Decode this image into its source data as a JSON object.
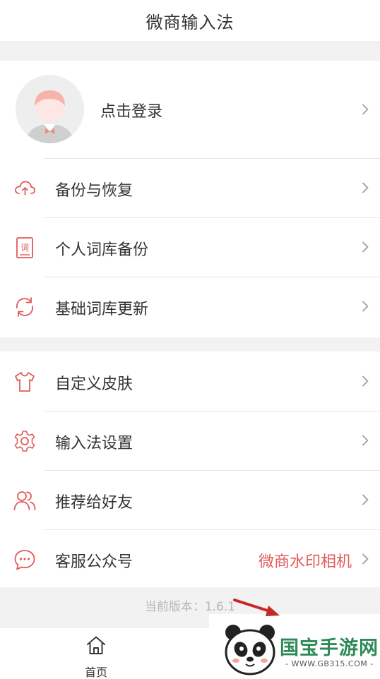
{
  "header": {
    "title": "微商输入法"
  },
  "profile": {
    "login_label": "点击登录"
  },
  "menu_group1": [
    {
      "label": "备份与恢复",
      "icon": "cloud-sync-icon"
    },
    {
      "label": "个人词库备份",
      "icon": "dictionary-icon"
    },
    {
      "label": "基础词库更新",
      "icon": "refresh-icon"
    }
  ],
  "menu_group2": [
    {
      "label": "自定义皮肤",
      "icon": "tshirt-icon"
    },
    {
      "label": "输入法设置",
      "icon": "gear-icon"
    },
    {
      "label": "推荐给好友",
      "icon": "users-icon"
    },
    {
      "label": "客服公众号",
      "icon": "chat-icon",
      "value": "微商水印相机"
    }
  ],
  "dict_icon_glyph": "词",
  "version": {
    "label": "当前版本：1.6.1"
  },
  "bottom_nav": {
    "home_label": "首页"
  },
  "watermark": {
    "brand": "国宝手游网",
    "url": "- WWW.GB315.COM -"
  },
  "colors": {
    "accent": "#e35a5a",
    "background": "#f2f2f2",
    "text": "#333333",
    "muted": "#b6b6b6"
  }
}
